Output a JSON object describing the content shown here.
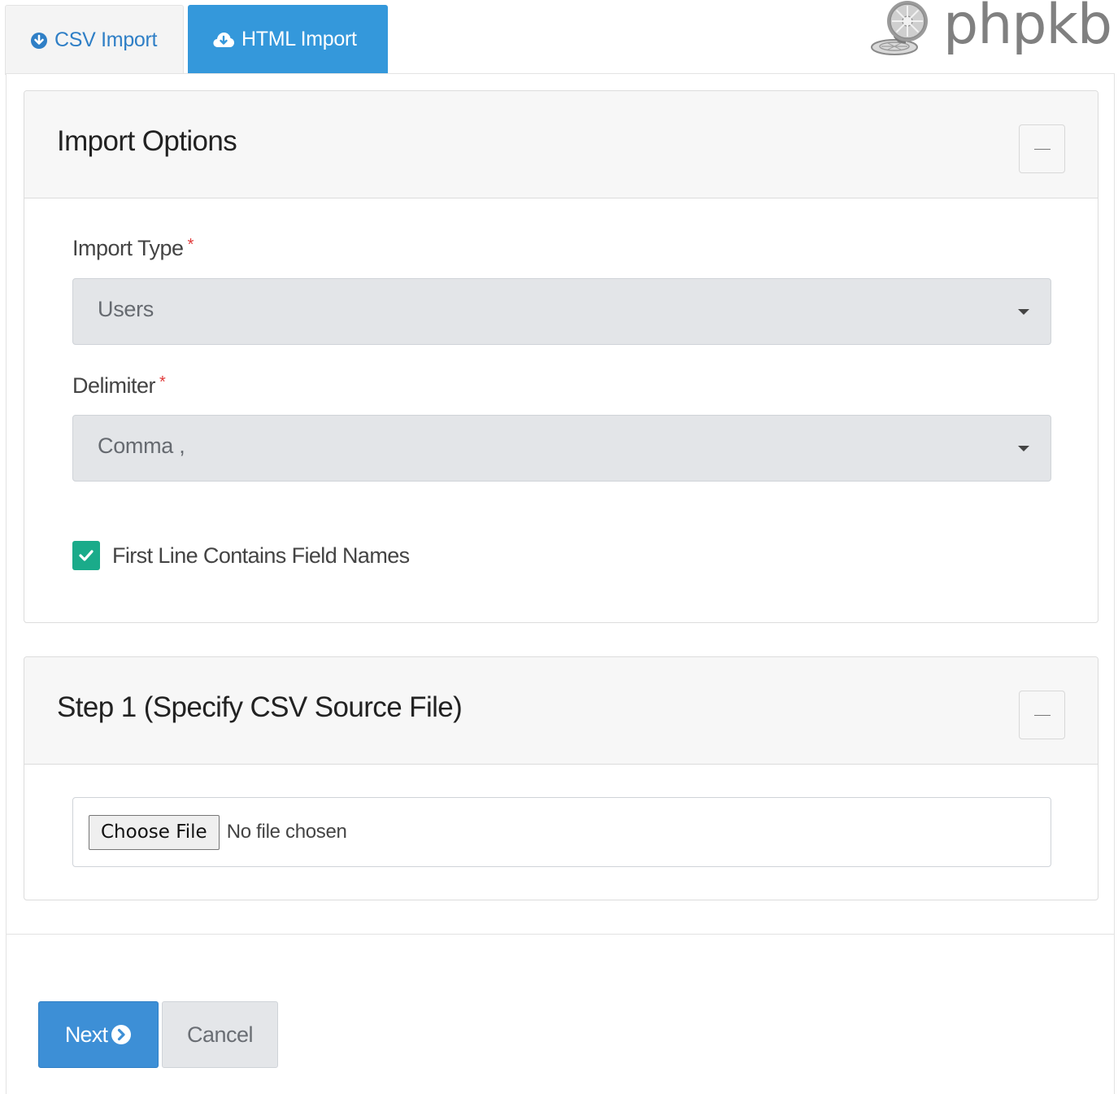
{
  "tabs": {
    "csv_label": "CSV Import",
    "html_label": "HTML Import"
  },
  "logo": {
    "text": "phpkb"
  },
  "import_options": {
    "title": "Import Options",
    "import_type_label": "Import Type",
    "import_type_value": "Users",
    "delimiter_label": "Delimiter",
    "delimiter_value": "Comma ,",
    "required_marker": "*",
    "first_line_label": "First Line Contains Field Names",
    "first_line_checked": true
  },
  "step1": {
    "title": "Step 1 (Specify CSV Source File)",
    "choose_file_label": "Choose File",
    "file_status": "No file chosen"
  },
  "actions": {
    "next_label": "Next",
    "cancel_label": "Cancel"
  },
  "colors": {
    "accent": "#3498db",
    "checkbox": "#1aab8a",
    "required": "#e03a3a"
  }
}
